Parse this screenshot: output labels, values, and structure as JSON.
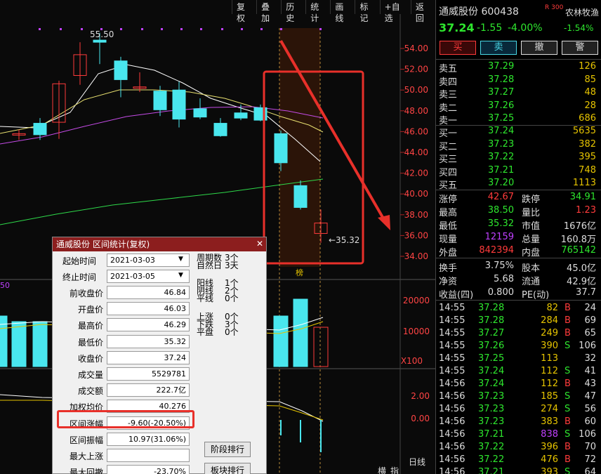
{
  "toolbar": [
    "复权",
    "叠加",
    "历史",
    "统计",
    "画线",
    "标记",
    "+自选",
    "返回"
  ],
  "stock": {
    "name": "通威股份",
    "code": "600438",
    "badge": "R",
    "badge_num": "300",
    "sector": "农林牧渔",
    "price": "37.24",
    "change": "-1.55",
    "pct": "-4.00%",
    "sector_pct": "-1.54%"
  },
  "actions": [
    "买",
    "卖",
    "撤",
    "警"
  ],
  "asks": [
    {
      "l": "卖五",
      "p": "37.29",
      "v": "126"
    },
    {
      "l": "卖四",
      "p": "37.28",
      "v": "85"
    },
    {
      "l": "卖三",
      "p": "37.27",
      "v": "48"
    },
    {
      "l": "卖二",
      "p": "37.26",
      "v": "28"
    },
    {
      "l": "卖一",
      "p": "37.25",
      "v": "686"
    }
  ],
  "bids": [
    {
      "l": "买一",
      "p": "37.24",
      "v": "5635"
    },
    {
      "l": "买二",
      "p": "37.23",
      "v": "382"
    },
    {
      "l": "买三",
      "p": "37.22",
      "v": "395"
    },
    {
      "l": "买四",
      "p": "37.21",
      "v": "748"
    },
    {
      "l": "买五",
      "p": "37.20",
      "v": "1113"
    }
  ],
  "stats": [
    {
      "a": "涨停",
      "av": "42.67",
      "ac": "red",
      "b": "跌停",
      "bv": "34.91",
      "bc": "green"
    },
    {
      "a": "最高",
      "av": "38.50",
      "ac": "green",
      "b": "量比",
      "bv": "1.23",
      "bc": "red"
    },
    {
      "a": "最低",
      "av": "35.32",
      "ac": "green",
      "b": "市值",
      "bv": "1676亿",
      "bc": "wht"
    },
    {
      "a": "现量",
      "av": "12159",
      "ac": "pur",
      "b": "总量",
      "bv": "160.8万",
      "bc": "wht"
    },
    {
      "a": "外盘",
      "av": "842394",
      "ac": "red",
      "b": "内盘",
      "bv": "765142",
      "bc": "green"
    },
    {
      "a": "换手",
      "av": "3.75%",
      "ac": "wht",
      "b": "股本",
      "bv": "45.0亿",
      "bc": "wht"
    },
    {
      "a": "净资",
      "av": "5.68",
      "ac": "wht",
      "b": "流通",
      "bv": "42.9亿",
      "bc": "wht"
    },
    {
      "a": "收益(四)",
      "av": "0.800",
      "ac": "wht",
      "b": "PE(动)",
      "bv": "37.7",
      "bc": "wht"
    }
  ],
  "ticks": [
    {
      "t": "14:55",
      "p": "37.28",
      "v": "82",
      "s": "B",
      "n": "24"
    },
    {
      "t": "14:55",
      "p": "37.28",
      "v": "284",
      "s": "B",
      "n": "69"
    },
    {
      "t": "14:55",
      "p": "37.27",
      "v": "249",
      "s": "B",
      "n": "65"
    },
    {
      "t": "14:55",
      "p": "37.26",
      "v": "390",
      "s": "S",
      "n": "106"
    },
    {
      "t": "14:55",
      "p": "37.25",
      "v": "113",
      "s": "",
      "n": "32"
    },
    {
      "t": "14:55",
      "p": "37.24",
      "v": "112",
      "s": "S",
      "n": "41"
    },
    {
      "t": "14:56",
      "p": "37.24",
      "v": "112",
      "s": "B",
      "n": "43"
    },
    {
      "t": "14:56",
      "p": "37.23",
      "v": "185",
      "s": "S",
      "n": "47"
    },
    {
      "t": "14:56",
      "p": "37.23",
      "v": "274",
      "s": "S",
      "n": "56"
    },
    {
      "t": "14:56",
      "p": "37.23",
      "v": "383",
      "s": "B",
      "n": "60"
    },
    {
      "t": "14:56",
      "p": "37.21",
      "v": "838",
      "s": "S",
      "n": "106"
    },
    {
      "t": "14:56",
      "p": "37.22",
      "v": "396",
      "s": "B",
      "n": "70"
    },
    {
      "t": "14:56",
      "p": "37.22",
      "v": "476",
      "s": "B",
      "n": "72"
    },
    {
      "t": "14:56",
      "p": "37.21",
      "v": "393",
      "s": "S",
      "n": "64"
    }
  ],
  "price_axis": [
    "54.00",
    "52.00",
    "50.00",
    "48.00",
    "46.00",
    "44.00",
    "42.00",
    "40.00",
    "38.00",
    "36.00",
    "34.00"
  ],
  "vol_axis": [
    "20000",
    "10000",
    "X100"
  ],
  "macd_axis": [
    "2.00",
    "0.00"
  ],
  "chart_labels": {
    "high": "55.50",
    "low": "35.32",
    "tag": "榜",
    "left_num": "50",
    "daily": "日线",
    "tab1": "横",
    "tab2": "指"
  },
  "dialog": {
    "title": "通威股份 区间统计(复权)",
    "start_label": "起始时间",
    "start": "2021-03-03",
    "end_label": "终止时间",
    "end": "2021-03-05",
    "fields": [
      {
        "l": "前收盘价",
        "v": "46.84"
      },
      {
        "l": "开盘价",
        "v": "46.03"
      },
      {
        "l": "最高价",
        "v": "46.29"
      },
      {
        "l": "最低价",
        "v": "35.32"
      },
      {
        "l": "收盘价",
        "v": "37.24"
      },
      {
        "l": "成交量",
        "v": "5529781"
      },
      {
        "l": "成交额",
        "v": "222.7亿"
      },
      {
        "l": "加权均价",
        "v": "40.276"
      },
      {
        "l": "区间涨幅",
        "v": "-9.60(-20.50%)"
      },
      {
        "l": "区间振幅",
        "v": "10.97(31.06%)"
      },
      {
        "l": "最大上涨",
        "v": ""
      },
      {
        "l": "最大回撤",
        "v": "-23.70%"
      }
    ],
    "p1": [
      "周期数",
      "3个",
      "自然日",
      "3天"
    ],
    "p2": [
      "阳线",
      "1个",
      "阴线",
      "2个",
      "平线",
      "0个"
    ],
    "p3": [
      "上涨",
      "0个",
      "下跌",
      "3个",
      "平盘",
      "0个"
    ],
    "btn1": "阶段排行",
    "btn2": "板块排行"
  }
}
